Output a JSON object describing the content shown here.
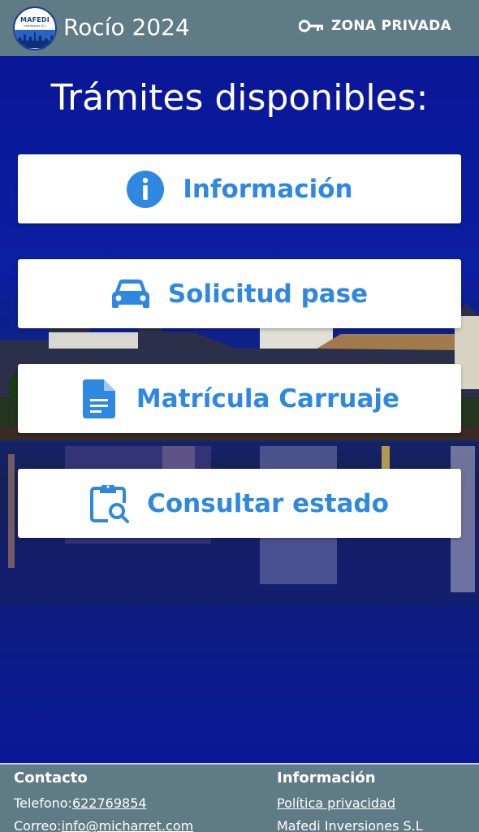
{
  "header": {
    "logo_text": "MAFEDI",
    "logo_sub": "Inversiones S.L",
    "title": "Rocío 2024",
    "zona_label": "ZONA PRIVADA",
    "zona_icon": "key-icon"
  },
  "main": {
    "heading": "Trámites disponibles:",
    "buttons": [
      {
        "label": "Información",
        "icon": "info-icon"
      },
      {
        "label": "Solicitud pase",
        "icon": "car-icon"
      },
      {
        "label": "Matrícula Carruaje",
        "icon": "document-icon"
      },
      {
        "label": "Consultar estado",
        "icon": "clipboard-search-icon"
      }
    ],
    "accent_color": "#2e88e1"
  },
  "footer": {
    "contact_heading": "Contacto",
    "phone_prefix": "Telefono:",
    "phone": "622769854",
    "email_prefix": "Correo:",
    "email": "info@micharret.com",
    "info_heading": "Información",
    "privacy_link": "Política privacidad",
    "company": "Mafedi Inversiones S.L"
  },
  "colors": {
    "header_bg": "#5f7b86",
    "background": "#0b1a9c"
  }
}
